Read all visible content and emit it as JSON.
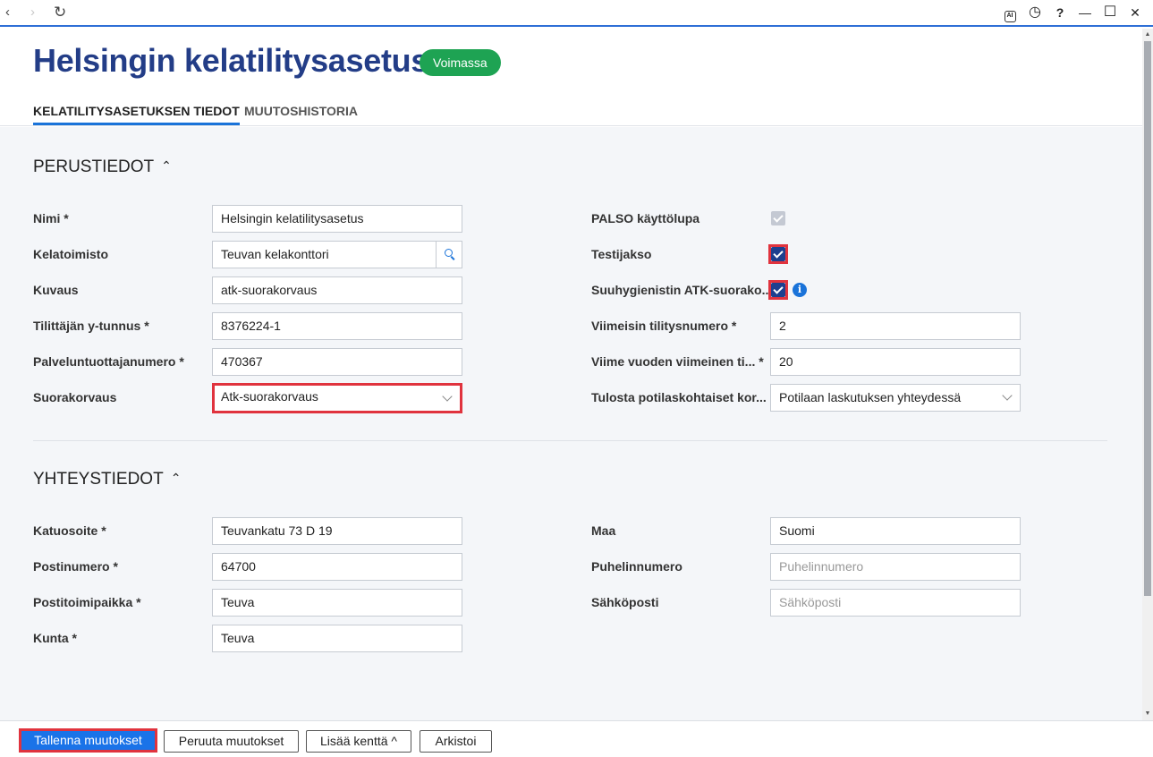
{
  "header": {
    "title": "Helsingin kelatilitysasetus",
    "status": "Voimassa",
    "tabs": [
      {
        "label": "KELATILITYSASETUKSEN TIEDOT",
        "active": true
      },
      {
        "label": "MUUTOSHISTORIA",
        "active": false
      }
    ]
  },
  "window": {
    "back_icon": "‹",
    "forward_icon": "›",
    "reload_icon": "↻",
    "ai_icon": "AI",
    "history_icon": "◷",
    "help_icon": "?",
    "minimize_icon": "—",
    "maximize_icon": "☐",
    "close_icon": "✕"
  },
  "perustiedot": {
    "title": "PERUSTIEDOT",
    "chevron": "⌃",
    "left": {
      "nimi_label": "Nimi *",
      "nimi_value": "Helsingin kelatilitysasetus",
      "kelatoimisto_label": "Kelatoimisto",
      "kelatoimisto_value": "Teuvan kelakonttori",
      "kuvaus_label": "Kuvaus",
      "kuvaus_value": "atk-suorakorvaus",
      "ytunnus_label": "Tilittäjän y-tunnus *",
      "ytunnus_value": "8376224-1",
      "palvelu_label": "Palveluntuottajanumero *",
      "palvelu_value": "470367",
      "suorakorvaus_label": "Suorakorvaus",
      "suorakorvaus_value": "Atk-suorakorvaus"
    },
    "right": {
      "palso_label": "PALSO käyttölupa",
      "testijakso_label": "Testijakso",
      "suuhyg_label": "Suuhygienistin ATK-suorako...",
      "info_icon": "i",
      "viimeisin_label": "Viimeisin tilitysnumero *",
      "viimeisin_value": "2",
      "viime_vuoden_label": "Viime vuoden viimeinen ti... *",
      "viime_vuoden_value": "20",
      "tulosta_label": "Tulosta potilaskohtaiset kor...",
      "tulosta_value": "Potilaan laskutuksen yhteydessä"
    }
  },
  "yhteystiedot": {
    "title": "YHTEYSTIEDOT",
    "chevron": "⌃",
    "left": {
      "katuosoite_label": "Katuosoite *",
      "katuosoite_value": "Teuvankatu 73 D 19",
      "postinumero_label": "Postinumero *",
      "postinumero_value": "64700",
      "postitoimipaikka_label": "Postitoimipaikka *",
      "postitoimipaikka_value": "Teuva",
      "kunta_label": "Kunta *",
      "kunta_value": "Teuva"
    },
    "right": {
      "maa_label": "Maa",
      "maa_value": "Suomi",
      "puhelin_label": "Puhelinnumero",
      "puhelin_placeholder": "Puhelinnumero",
      "sahkoposti_label": "Sähköposti",
      "sahkoposti_placeholder": "Sähköposti"
    }
  },
  "footer": {
    "save": "Tallenna muutokset",
    "cancel": "Peruuta muutokset",
    "add_field": "Lisää kenttä ^",
    "archive": "Arkistoi"
  },
  "colors": {
    "title": "#233d87",
    "status_badge": "#1ea353",
    "accent": "#1a73d9",
    "highlight": "#e0333e",
    "checkbox": "#1d3f8f"
  }
}
